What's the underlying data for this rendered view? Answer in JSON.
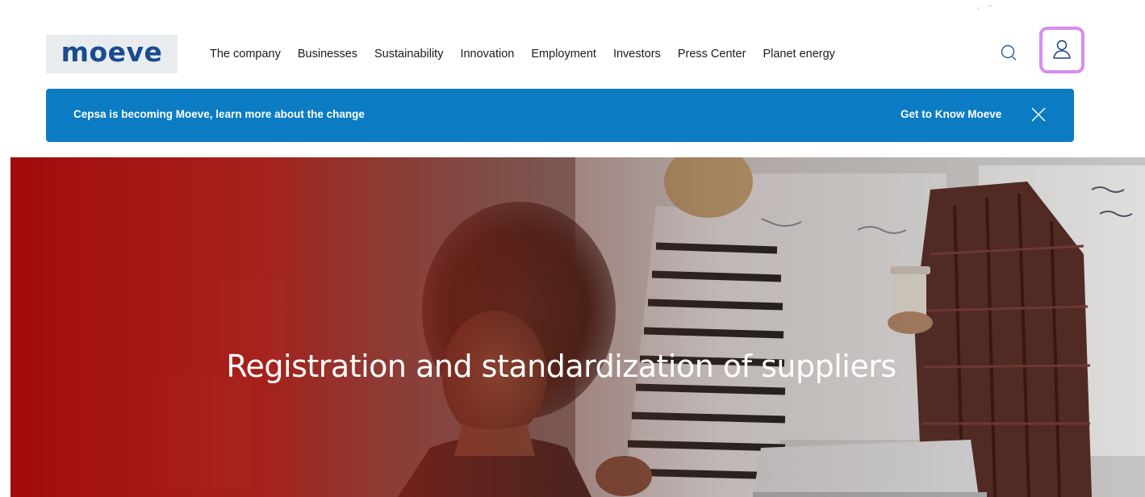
{
  "brand": {
    "logo_text": "moeve"
  },
  "nav": {
    "items": [
      {
        "label": "The company"
      },
      {
        "label": "Businesses"
      },
      {
        "label": "Sustainability"
      },
      {
        "label": "Innovation"
      },
      {
        "label": "Employment"
      },
      {
        "label": "Investors"
      },
      {
        "label": "Press Center"
      },
      {
        "label": "Planet energy"
      }
    ]
  },
  "header_actions": {
    "search_icon": "search-icon",
    "user_icon": "user-icon",
    "user_highlight_color": "#d78ef0"
  },
  "banner": {
    "text": "Cepsa is becoming Moeve, learn more about the change",
    "link_label": "Get to Know Moeve",
    "close_icon": "close-icon",
    "background_color": "#0b7cc4"
  },
  "hero": {
    "title": "Registration and standardization of suppliers",
    "accent_color": "#a10e0e"
  }
}
